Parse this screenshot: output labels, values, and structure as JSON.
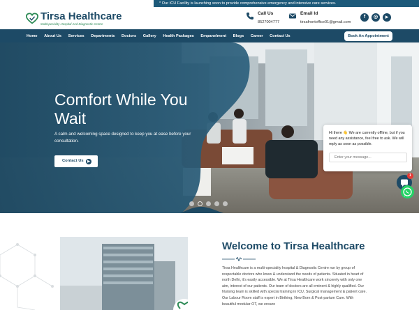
{
  "topbar": {
    "marquee": "* Our ICU Facility is launching soon to provide comprehensive emergency and intensive care services."
  },
  "brand": {
    "name": "Tirsa Healthcare",
    "tagline": "Multispeciality Hospital And Diagnostic Centre"
  },
  "contact": {
    "call_label": "Call Us",
    "call_value": "8527004777",
    "email_label": "Email Id",
    "email_value": "tirsafrontoffice01@gmail.com"
  },
  "socials": [
    {
      "icon": "facebook-icon",
      "glyph": "f"
    },
    {
      "icon": "instagram-icon",
      "glyph": "◎"
    },
    {
      "icon": "youtube-icon",
      "glyph": "▶"
    }
  ],
  "nav": {
    "items": [
      "Home",
      "About Us",
      "Services",
      "Departments",
      "Doctors",
      "Gallery",
      "Health Packages",
      "Empanelment",
      "Blogs",
      "Career",
      "Contact Us"
    ],
    "cta": "Book An Appointment"
  },
  "hero": {
    "heading": "Comfort While You Wait",
    "subtext": "A calm and welcoming space designed to keep you at ease before your consultation.",
    "button": "Contact Us",
    "slides_total": 5,
    "active_slide": 2
  },
  "chat": {
    "message": "Hi there 👋 We are currently offline, but if you need any assistance, feel free to ask. We will reply as soon as possible.",
    "placeholder": "Enter your message...",
    "badge": "1"
  },
  "about": {
    "title": "Welcome to Tirsa Healthcare",
    "body": "Tirsa Healthcare is a multi-speciality hospital & Diagnostic Centre run by group of respectable doctors who knew & understand the needs of patients. Situated in heart of north Delhi, it's easily accessible. We at Tirsa Healthcare work sincerely with only one aim, interest of our patients. Our team of doctors are all eminent & highly qualified. Our Nursing team is skilled with special training in ICU, Surgical management & patient care. Our Labour Room staff is expert in Birthing, New Born & Post-partum Care. With beautiful modular OT, we ensure"
  },
  "colors": {
    "brand": "#1d4a66",
    "accent_green": "#2e8b57",
    "whatsapp": "#25d366",
    "badge_red": "#e53935"
  }
}
